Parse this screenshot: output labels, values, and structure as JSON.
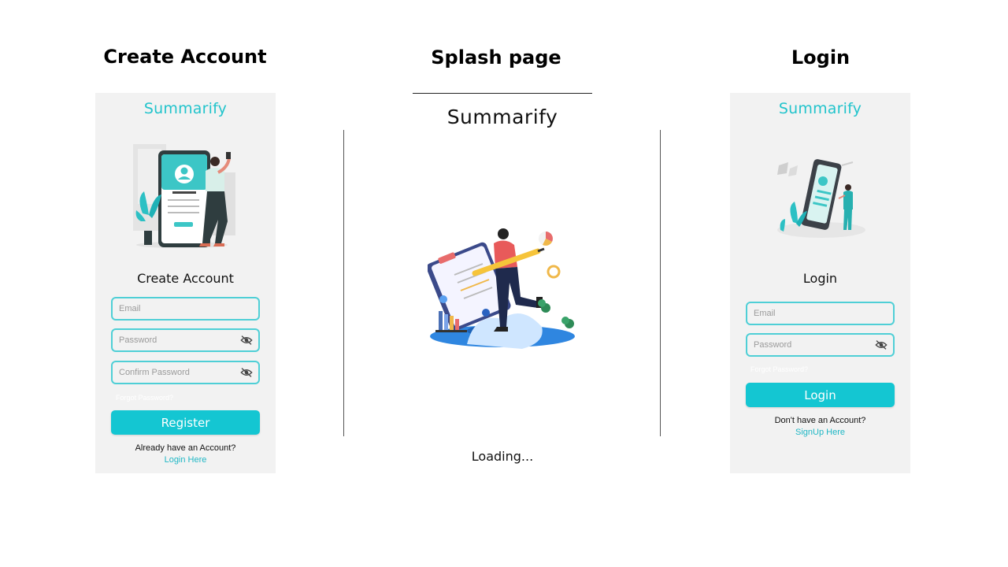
{
  "sections": {
    "create": "Create Account",
    "splash": "Splash page",
    "login": "Login"
  },
  "create_panel": {
    "brand": "Summarify",
    "title": "Create Account",
    "email_placeholder": "Email",
    "password_placeholder": "Password",
    "confirm_placeholder": "Confirm Password",
    "forgot": "Forgot Password?",
    "register": "Register",
    "footer": "Already have an Account?",
    "footer_link": "Login Here"
  },
  "splash_panel": {
    "brand": "Summarify",
    "loading": "Loading..."
  },
  "login_panel": {
    "brand": "Summarify",
    "title": "Login",
    "email_placeholder": "Email",
    "password_placeholder": "Password",
    "forgot": "Forgot Password?",
    "login": "Login",
    "footer": "Don't have an Account?",
    "footer_link": "SignUp Here"
  },
  "colors": {
    "accent": "#14c6d2",
    "field_border": "#4fcfd6",
    "panel_bg": "#f2f2f2",
    "link": "#1fb7c5"
  },
  "icons": [
    "eye-off-icon",
    "signup-illustration",
    "splash-illustration",
    "login-illustration"
  ]
}
